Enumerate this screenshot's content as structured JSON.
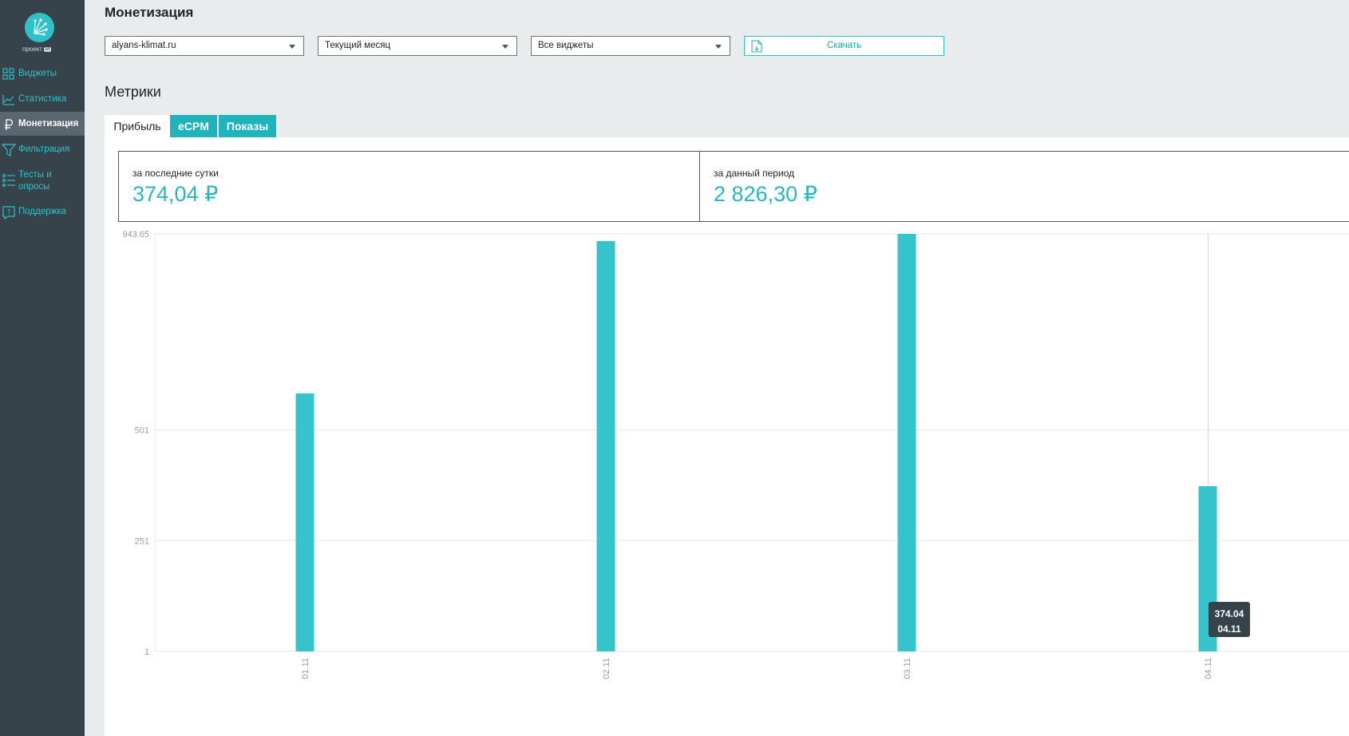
{
  "sidebar": {
    "logo_text": "проект",
    "logo_badge": "M",
    "items": [
      {
        "label": "Виджеты",
        "icon": "widgets-icon"
      },
      {
        "label": "Статистика",
        "icon": "stats-chart-icon"
      },
      {
        "label": "Монетизация",
        "icon": "ruble-icon",
        "active": true
      },
      {
        "label": "Фильтрация",
        "icon": "filter-icon"
      },
      {
        "label": "Тесты и опросы",
        "icon": "list-icon"
      },
      {
        "label": "Поддержка",
        "icon": "help-bubble-icon"
      }
    ]
  },
  "header": {
    "title": "Монетизация"
  },
  "filters": {
    "site": "alyans-klimat.ru",
    "period": "Текущий месяц",
    "widgets": "Все виджеты",
    "download_label": "Скачать"
  },
  "metrics_section": {
    "title": "Метрики",
    "tabs": [
      {
        "label": "Прибыль",
        "active": true
      },
      {
        "label": "eCPM",
        "active": false
      },
      {
        "label": "Показы",
        "active": false
      }
    ],
    "cards": [
      {
        "label": "за последние сутки",
        "value": "374,04 ₽"
      },
      {
        "label": "за данный период",
        "value": "2 826,30 ₽"
      }
    ]
  },
  "colors": {
    "accent": "#2ec1c8",
    "sidebar_bg": "#37434b",
    "bar": "#35c4cc"
  },
  "chart_data": {
    "type": "bar",
    "categories": [
      "01.11",
      "02.11",
      "03.11",
      "04.11"
    ],
    "values": [
      583.5,
      927.5,
      943.65,
      374.04
    ],
    "yticks": [
      "1",
      "251",
      "501",
      "943.65"
    ],
    "ylim": [
      1,
      943.65
    ],
    "grid": true,
    "tooltip": {
      "value": "374.04",
      "label": "04.11"
    }
  }
}
